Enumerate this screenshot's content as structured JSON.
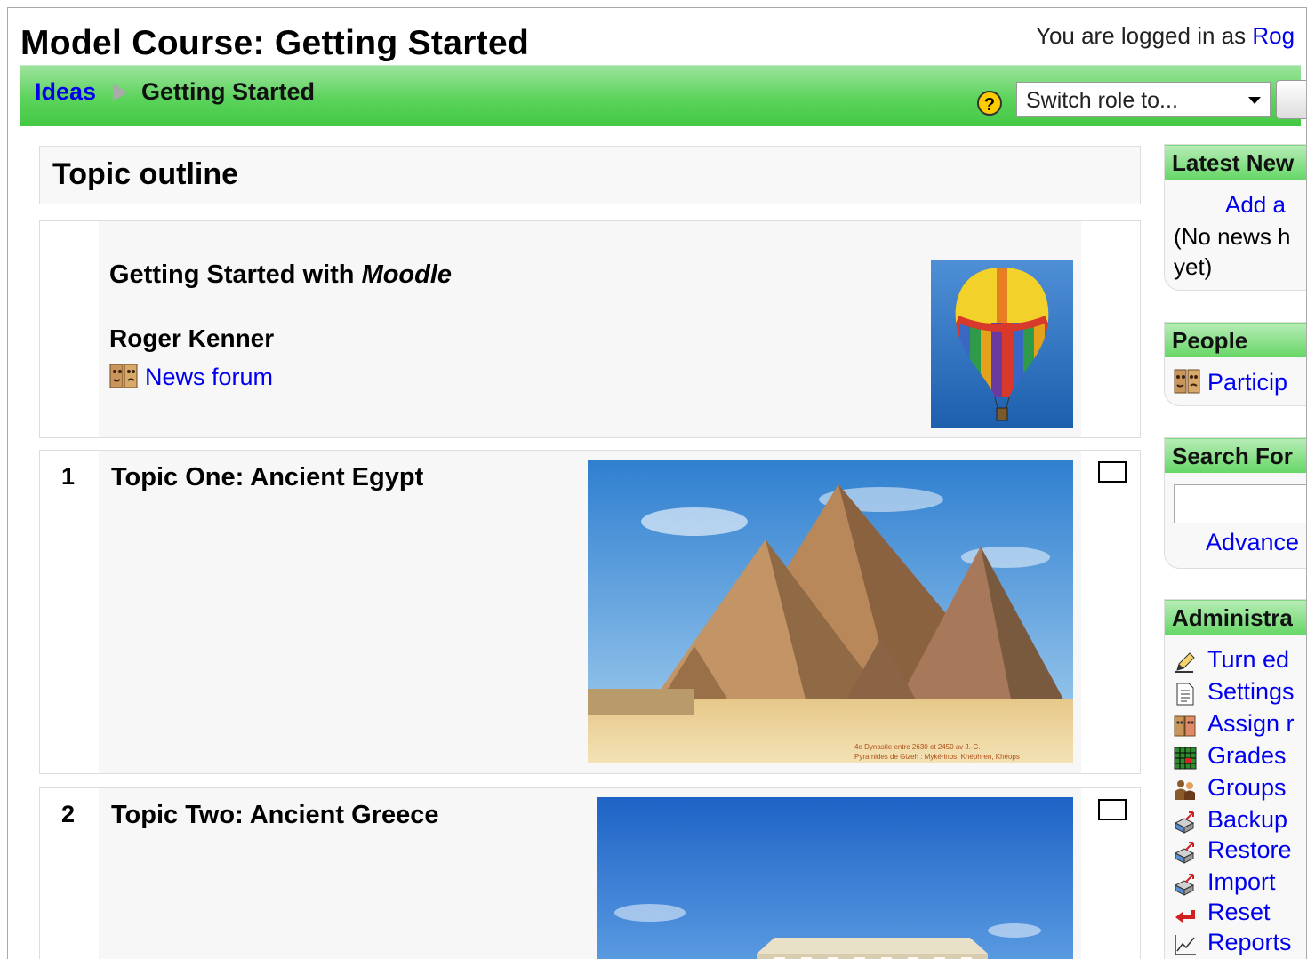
{
  "header": {
    "course_title": "Model Course: Getting Started",
    "login_prefix": "You are logged in as ",
    "login_user": "Rog"
  },
  "navbar": {
    "breadcrumb_root": "Ideas",
    "breadcrumb_current": "Getting Started",
    "role_select_value": "Switch role to..."
  },
  "main": {
    "outline_title": "Topic outline",
    "section0": {
      "heading_prefix": "Getting Started with ",
      "heading_emph": "Moodle",
      "teacher": "Roger Kenner",
      "forum_link": "News forum"
    },
    "sections": [
      {
        "number": "1",
        "title": "Topic One: Ancient Egypt",
        "caption_line1": "4e Dynastie entre 2630 et 2450 av J.-C.",
        "caption_line2": "Pyramides de Gizeh : Mykérinos, Khéphren, Khéops"
      },
      {
        "number": "2",
        "title": "Topic Two: Ancient Greece"
      }
    ]
  },
  "sidebar": {
    "latest_news": {
      "title": "Latest New",
      "add_link": "Add a",
      "empty_line1": "(No news h",
      "empty_line2": "yet)"
    },
    "people": {
      "title": "People",
      "participants": "Particip"
    },
    "search": {
      "title": "Search For",
      "advanced": "Advance"
    },
    "admin": {
      "title": "Administra",
      "items": [
        {
          "label": "Turn ed",
          "icon": "edit-pencil-icon"
        },
        {
          "label": "Settings",
          "icon": "settings-document-icon"
        },
        {
          "label": "Assign r",
          "icon": "assign-roles-icon"
        },
        {
          "label": "Grades",
          "icon": "grades-grid-icon"
        },
        {
          "label": "Groups",
          "icon": "groups-people-icon"
        },
        {
          "label": "Backup",
          "icon": "backup-box-icon"
        },
        {
          "label": "Restore",
          "icon": "restore-box-icon"
        },
        {
          "label": "Import",
          "icon": "import-box-icon"
        },
        {
          "label": "Reset",
          "icon": "reset-arrow-icon"
        },
        {
          "label": "Reports",
          "icon": "reports-chart-icon"
        }
      ]
    }
  },
  "colors": {
    "nav_green": "#5bd35b",
    "link": "#0000ee"
  }
}
